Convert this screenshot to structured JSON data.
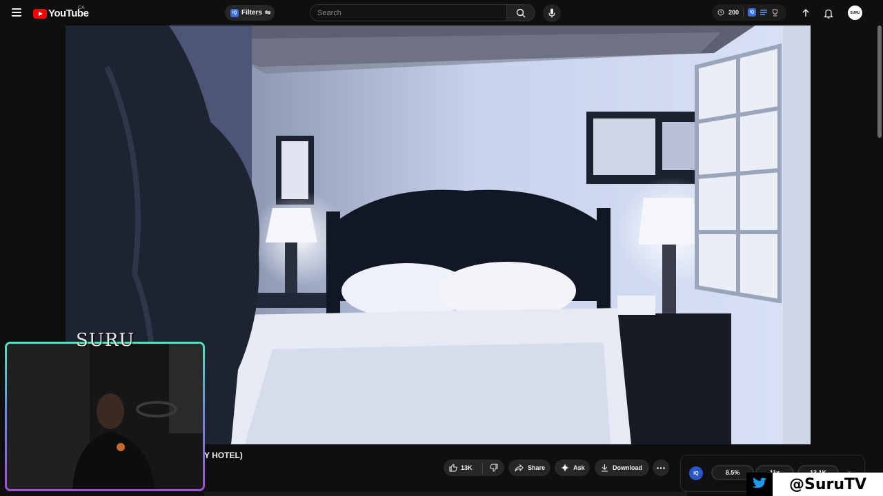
{
  "header": {
    "logo_text": "YouTube",
    "logo_region": "CA",
    "filters_label": "Filters",
    "iq_badge": "IQ",
    "search_placeholder": "Search",
    "ext_count": "200",
    "avatar_text": "SURU"
  },
  "video": {
    "title_fragment": "Y HOTEL)",
    "likes": "13K",
    "share_label": "Share",
    "ask_label": "Ask",
    "download_label": "Download"
  },
  "iq_panel": {
    "logo": "IQ",
    "metric_1": "8.5%",
    "metric_2": "11x",
    "metric_3": "13.1K",
    "close": "×"
  },
  "webcam": {
    "label": "SURU"
  },
  "social": {
    "twitter_handle": "@SuruTV"
  },
  "icons": [
    "menu-icon",
    "search-icon",
    "mic-icon",
    "clock-icon",
    "upload-icon",
    "bell-icon",
    "thumbs-up-icon",
    "thumbs-down-icon",
    "share-icon",
    "sparkle-icon",
    "download-icon",
    "more-icon",
    "twitter-icon"
  ],
  "colors": {
    "brand_red": "#ff0000",
    "iq_blue": "#2957c8",
    "cam_border_top": "#4ee6b8",
    "cam_border_bottom": "#a04fd8",
    "twitter_blue": "#1d9bf0"
  }
}
